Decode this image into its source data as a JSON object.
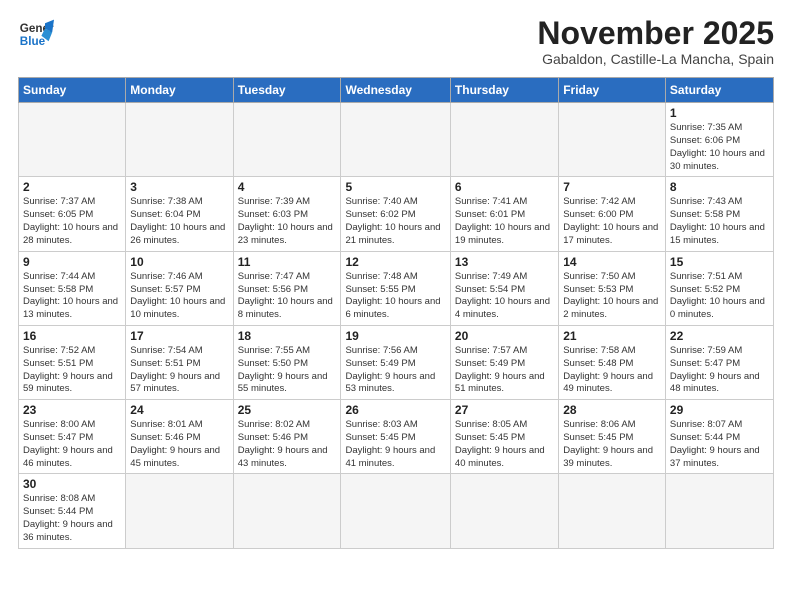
{
  "header": {
    "logo_general": "General",
    "logo_blue": "Blue",
    "month": "November 2025",
    "location": "Gabaldon, Castille-La Mancha, Spain"
  },
  "weekdays": [
    "Sunday",
    "Monday",
    "Tuesday",
    "Wednesday",
    "Thursday",
    "Friday",
    "Saturday"
  ],
  "weeks": [
    [
      {
        "day": "",
        "info": ""
      },
      {
        "day": "",
        "info": ""
      },
      {
        "day": "",
        "info": ""
      },
      {
        "day": "",
        "info": ""
      },
      {
        "day": "",
        "info": ""
      },
      {
        "day": "",
        "info": ""
      },
      {
        "day": "1",
        "info": "Sunrise: 7:35 AM\nSunset: 6:06 PM\nDaylight: 10 hours and 30 minutes."
      }
    ],
    [
      {
        "day": "2",
        "info": "Sunrise: 7:37 AM\nSunset: 6:05 PM\nDaylight: 10 hours and 28 minutes."
      },
      {
        "day": "3",
        "info": "Sunrise: 7:38 AM\nSunset: 6:04 PM\nDaylight: 10 hours and 26 minutes."
      },
      {
        "day": "4",
        "info": "Sunrise: 7:39 AM\nSunset: 6:03 PM\nDaylight: 10 hours and 23 minutes."
      },
      {
        "day": "5",
        "info": "Sunrise: 7:40 AM\nSunset: 6:02 PM\nDaylight: 10 hours and 21 minutes."
      },
      {
        "day": "6",
        "info": "Sunrise: 7:41 AM\nSunset: 6:01 PM\nDaylight: 10 hours and 19 minutes."
      },
      {
        "day": "7",
        "info": "Sunrise: 7:42 AM\nSunset: 6:00 PM\nDaylight: 10 hours and 17 minutes."
      },
      {
        "day": "8",
        "info": "Sunrise: 7:43 AM\nSunset: 5:58 PM\nDaylight: 10 hours and 15 minutes."
      }
    ],
    [
      {
        "day": "9",
        "info": "Sunrise: 7:44 AM\nSunset: 5:58 PM\nDaylight: 10 hours and 13 minutes."
      },
      {
        "day": "10",
        "info": "Sunrise: 7:46 AM\nSunset: 5:57 PM\nDaylight: 10 hours and 10 minutes."
      },
      {
        "day": "11",
        "info": "Sunrise: 7:47 AM\nSunset: 5:56 PM\nDaylight: 10 hours and 8 minutes."
      },
      {
        "day": "12",
        "info": "Sunrise: 7:48 AM\nSunset: 5:55 PM\nDaylight: 10 hours and 6 minutes."
      },
      {
        "day": "13",
        "info": "Sunrise: 7:49 AM\nSunset: 5:54 PM\nDaylight: 10 hours and 4 minutes."
      },
      {
        "day": "14",
        "info": "Sunrise: 7:50 AM\nSunset: 5:53 PM\nDaylight: 10 hours and 2 minutes."
      },
      {
        "day": "15",
        "info": "Sunrise: 7:51 AM\nSunset: 5:52 PM\nDaylight: 10 hours and 0 minutes."
      }
    ],
    [
      {
        "day": "16",
        "info": "Sunrise: 7:52 AM\nSunset: 5:51 PM\nDaylight: 9 hours and 59 minutes."
      },
      {
        "day": "17",
        "info": "Sunrise: 7:54 AM\nSunset: 5:51 PM\nDaylight: 9 hours and 57 minutes."
      },
      {
        "day": "18",
        "info": "Sunrise: 7:55 AM\nSunset: 5:50 PM\nDaylight: 9 hours and 55 minutes."
      },
      {
        "day": "19",
        "info": "Sunrise: 7:56 AM\nSunset: 5:49 PM\nDaylight: 9 hours and 53 minutes."
      },
      {
        "day": "20",
        "info": "Sunrise: 7:57 AM\nSunset: 5:49 PM\nDaylight: 9 hours and 51 minutes."
      },
      {
        "day": "21",
        "info": "Sunrise: 7:58 AM\nSunset: 5:48 PM\nDaylight: 9 hours and 49 minutes."
      },
      {
        "day": "22",
        "info": "Sunrise: 7:59 AM\nSunset: 5:47 PM\nDaylight: 9 hours and 48 minutes."
      }
    ],
    [
      {
        "day": "23",
        "info": "Sunrise: 8:00 AM\nSunset: 5:47 PM\nDaylight: 9 hours and 46 minutes."
      },
      {
        "day": "24",
        "info": "Sunrise: 8:01 AM\nSunset: 5:46 PM\nDaylight: 9 hours and 45 minutes."
      },
      {
        "day": "25",
        "info": "Sunrise: 8:02 AM\nSunset: 5:46 PM\nDaylight: 9 hours and 43 minutes."
      },
      {
        "day": "26",
        "info": "Sunrise: 8:03 AM\nSunset: 5:45 PM\nDaylight: 9 hours and 41 minutes."
      },
      {
        "day": "27",
        "info": "Sunrise: 8:05 AM\nSunset: 5:45 PM\nDaylight: 9 hours and 40 minutes."
      },
      {
        "day": "28",
        "info": "Sunrise: 8:06 AM\nSunset: 5:45 PM\nDaylight: 9 hours and 39 minutes."
      },
      {
        "day": "29",
        "info": "Sunrise: 8:07 AM\nSunset: 5:44 PM\nDaylight: 9 hours and 37 minutes."
      }
    ],
    [
      {
        "day": "30",
        "info": "Sunrise: 8:08 AM\nSunset: 5:44 PM\nDaylight: 9 hours and 36 minutes."
      },
      {
        "day": "",
        "info": ""
      },
      {
        "day": "",
        "info": ""
      },
      {
        "day": "",
        "info": ""
      },
      {
        "day": "",
        "info": ""
      },
      {
        "day": "",
        "info": ""
      },
      {
        "day": "",
        "info": ""
      }
    ]
  ]
}
